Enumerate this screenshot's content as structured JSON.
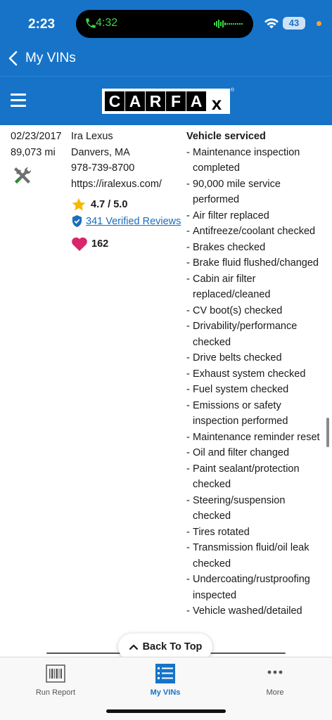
{
  "status_bar": {
    "time": "2:23",
    "call_time": "4:32",
    "battery": "43"
  },
  "nav": {
    "back_label": "My VINs"
  },
  "header": {
    "logo_letters": [
      "C",
      "A",
      "R",
      "F",
      "A",
      "x"
    ],
    "logo_trademark": "®"
  },
  "record": {
    "date": "02/23/2017",
    "mileage": "89,073 mi",
    "dealer_name": "Ira Lexus",
    "location": "Danvers, MA",
    "phone": "978-739-8700",
    "website": "https://iralexus.com/",
    "rating": "4.7 / 5.0",
    "reviews": "341 Verified Reviews",
    "favorites": "162",
    "service_heading": "Vehicle serviced",
    "service_items": [
      "Maintenance inspection completed",
      "90,000 mile service performed",
      "Air filter replaced",
      "Antifreeze/coolant checked",
      "Brakes checked",
      "Brake fluid flushed/changed",
      "Cabin air filter replaced/cleaned",
      "CV boot(s) checked",
      "Drivability/performance checked",
      "Drive belts checked",
      "Exhaust system checked",
      "Fuel system checked",
      "Emissions or safety inspection performed",
      "Maintenance reminder reset",
      "Oil and filter changed",
      "Paint sealant/protection checked",
      "Steering/suspension checked",
      "Tires rotated",
      "Transmission fluid/oil leak checked",
      "Undercoating/rustproofing inspected",
      "Vehicle washed/detailed"
    ]
  },
  "back_to_top": "Back To Top",
  "tabs": [
    {
      "label": "Run Report",
      "icon": "barcode-icon"
    },
    {
      "label": "My VINs",
      "icon": "list-icon"
    },
    {
      "label": "More",
      "icon": "more-icon"
    }
  ],
  "colors": {
    "brand_blue": "#1673c8",
    "link_blue": "#1b6ebd",
    "star": "#f5b800",
    "heart": "#d8266a"
  }
}
